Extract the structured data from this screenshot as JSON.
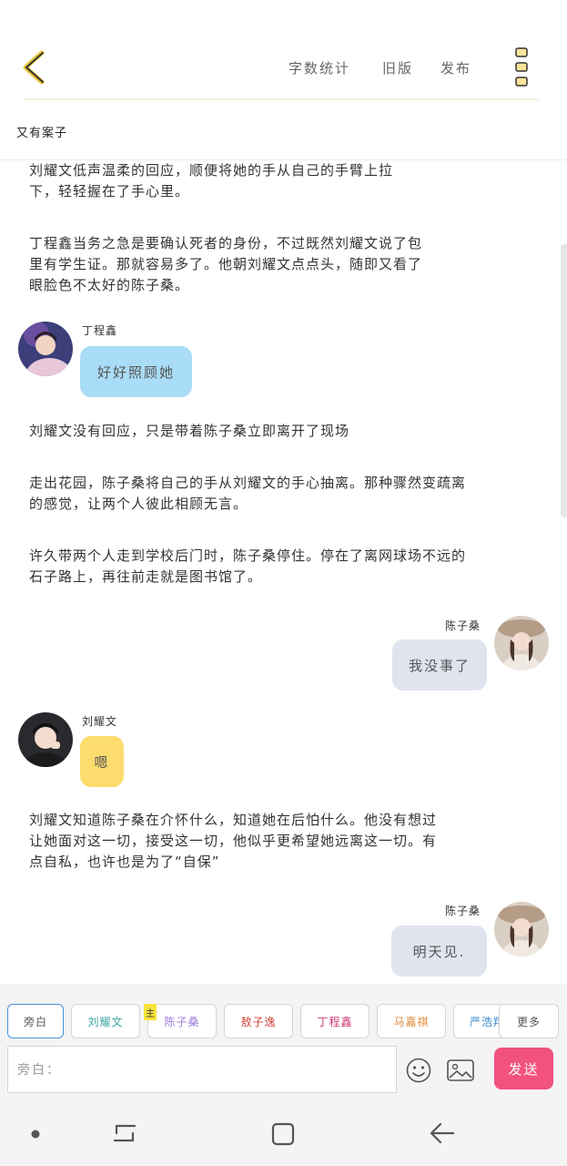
{
  "header": {
    "menu": [
      "字数统计",
      "旧版",
      "发布"
    ],
    "accent_color": "#e8c437",
    "back_icon": "chevron-left-icon",
    "more_icon": "vertical-dots-icon"
  },
  "subtitle": "又有案子",
  "content": {
    "paragraphs": [
      [
        "刘耀文低声温柔的回应，顺便将她的手从自己的手臂上拉",
        "下，轻轻握在了手心里。"
      ],
      [
        "丁程鑫当务之急是要确认死者的身份，不过既然刘耀文说了包",
        "里有学生证。那就容易多了。他朝刘耀文点点头，随即又看了",
        "眼脸色不太好的陈子桑。"
      ],
      [
        "刘耀文没有回应，只是带着陈子桑立即离开了现场"
      ],
      [
        "走出花园，陈子桑将自己的手从刘耀文的手心抽离。那种骤然变疏离",
        "的感觉，让两个人彼此相顾无言。"
      ],
      [
        "许久带两个人走到学校后门时，陈子桑停住。停在了离网球场不远的",
        "石子路上，再往前走就是图书馆了。"
      ],
      [
        "刘耀文知道陈子桑在介怀什么，知道她在后怕什么。他没有想过",
        "让她面对这一切，接受这一切，他似乎更希望她远离这一切。有",
        "点自私，也许也是为了“自保”"
      ]
    ],
    "messages": [
      {
        "speaker": "丁程鑫",
        "text": "好好照顾她",
        "side": "left",
        "color": "#a9dcf7"
      },
      {
        "speaker": "陈子桑",
        "text": "我没事了",
        "side": "right",
        "color": "#dfe4ee"
      },
      {
        "speaker": "刘耀文",
        "text": "嗯",
        "side": "left",
        "color": "#fbdc6d"
      },
      {
        "speaker": "陈子桑",
        "text": "明天见.",
        "side": "right",
        "color": "#dfe4ee"
      }
    ]
  },
  "characters": [
    {
      "label": "旁白",
      "color": "#555555"
    },
    {
      "label": "刘耀文",
      "color": "#3aa4a4"
    },
    {
      "label": "陈子桑",
      "color": "#9a7ad8"
    },
    {
      "label": "敖子逸",
      "color": "#d0453a"
    },
    {
      "label": "丁程鑫",
      "color": "#d03a76"
    },
    {
      "label": "马嘉祺",
      "color": "#e0883a"
    },
    {
      "label": "严浩翔",
      "color": "#3a8ad0"
    },
    {
      "label": "更多",
      "color": "#555555"
    }
  ],
  "main_tag": "主",
  "input": {
    "placeholder": "旁白："
  },
  "send_label": "发送",
  "icons": {
    "emoji": "smiley-icon",
    "image": "image-icon"
  }
}
